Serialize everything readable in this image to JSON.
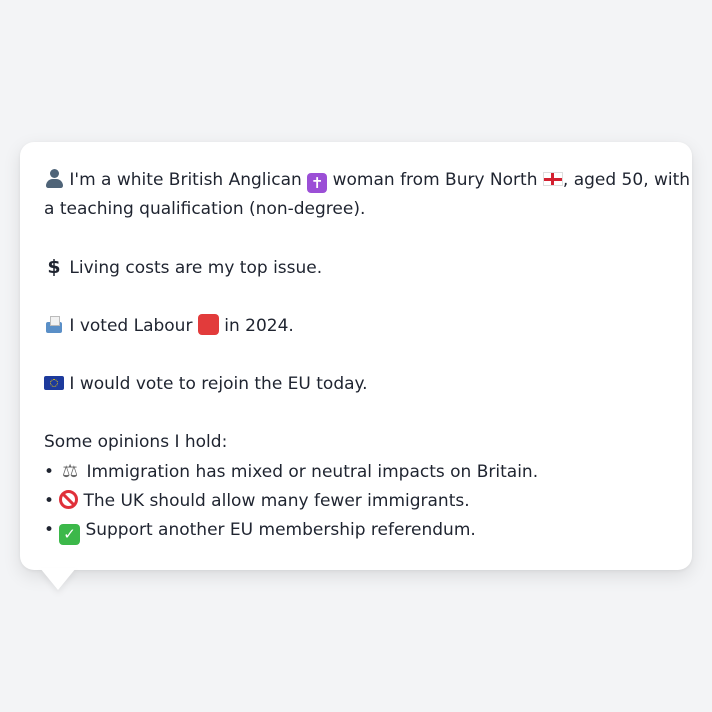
{
  "card": {
    "profile_line1": "I'm a white British Anglican",
    "profile_line2": "woman from Bury North",
    "profile_line3": ", aged 50, with",
    "profile_line4": "a teaching qualification (non-degree).",
    "issue": "Living costs are my top issue.",
    "vote_prefix": "I voted Labour",
    "vote_suffix": "in 2024.",
    "eu": "I would vote to rejoin the EU today.",
    "opinions_heading": "Some opinions I hold:",
    "bullet": "•",
    "opinions": [
      "Immigration has mixed or neutral impacts on Britain.",
      "The UK should allow many fewer immigrants.",
      "Support another EU membership referendum."
    ]
  },
  "icons": {
    "person": "bust-in-silhouette-icon",
    "cross": "latin-cross-icon",
    "flag": "england-flag-icon",
    "dollar": "heavy-dollar-sign-icon",
    "ballot": "ballot-box-icon",
    "party": "red-square-icon",
    "eu_flag": "eu-flag-icon",
    "scales": "balance-scale-icon",
    "no_entry": "prohibited-icon",
    "check": "check-mark-button-icon"
  },
  "glyphs": {
    "cross": "✝",
    "dollar": "$",
    "scales": "⚖",
    "check": "✓"
  },
  "colors": {
    "background": "#f3f4f6",
    "card": "#ffffff",
    "text": "#1f2430",
    "party_red": "#e23b3b",
    "check_green": "#3cb84a",
    "no_entry_red": "#e0303a"
  }
}
